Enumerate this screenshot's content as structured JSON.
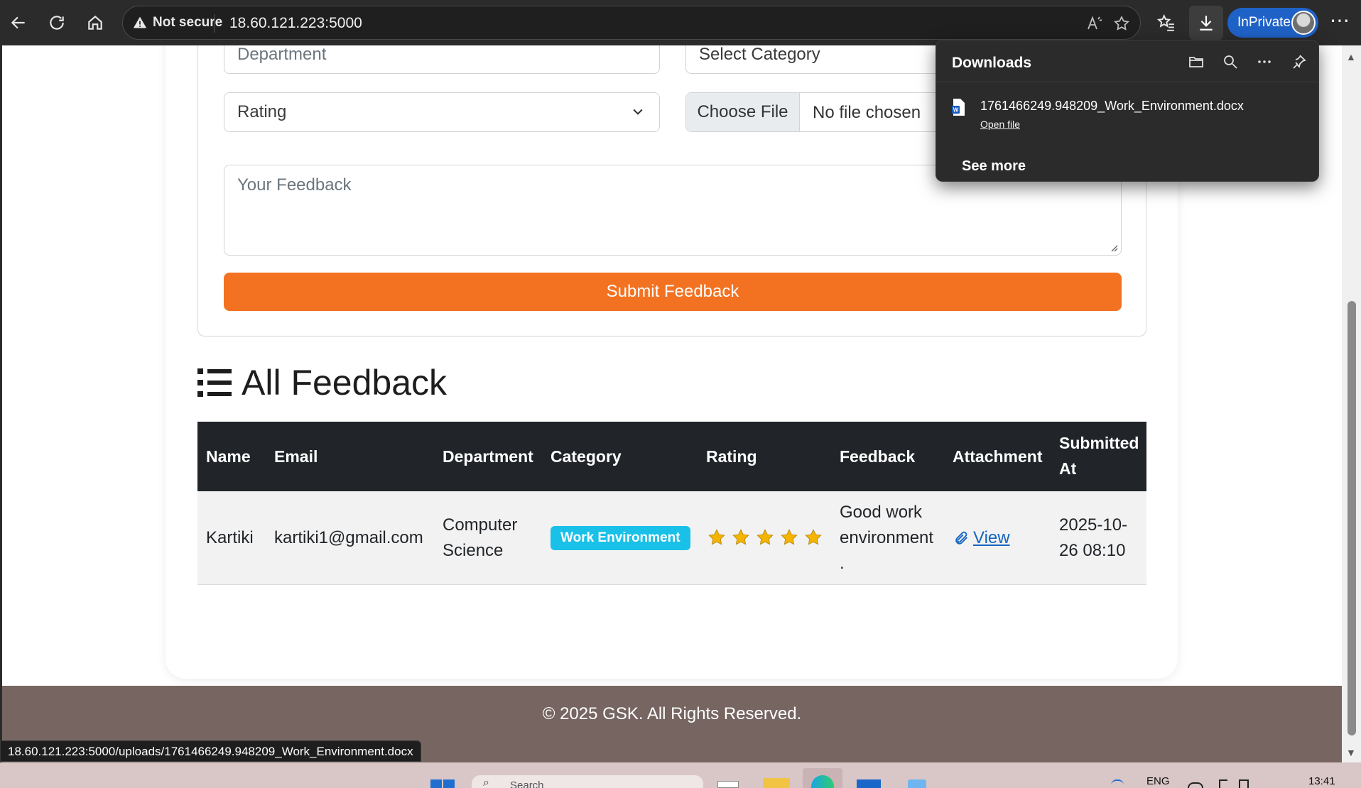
{
  "browser": {
    "security_label": "Not secure",
    "url": "18.60.121.223:5000",
    "inprivate_label": "InPrivate",
    "more_label": "⋯"
  },
  "downloads": {
    "title": "Downloads",
    "file_name": "1761466249.948209_Work_Environment.docx",
    "open_file_label": "Open file",
    "see_more_label": "See more"
  },
  "form": {
    "department_placeholder": "Department",
    "category_placeholder": "Select Category",
    "rating_placeholder": "Rating",
    "choose_file_label": "Choose File",
    "no_file_label": "No file chosen",
    "feedback_placeholder": "Your Feedback",
    "submit_label": "Submit Feedback"
  },
  "feedback_section": {
    "heading": "All Feedback",
    "columns": {
      "name": "Name",
      "email": "Email",
      "department": "Department",
      "category": "Category",
      "rating": "Rating",
      "feedback": "Feedback",
      "attachment": "Attachment",
      "submitted_line1": "Submitted",
      "submitted_line2": "At"
    },
    "rows": [
      {
        "name": "Kartiki",
        "email": "kartiki1@gmail.com",
        "department_line1": "Computer",
        "department_line2": "Science",
        "category": "Work Environment",
        "rating": 5,
        "feedback_line1": "Good work",
        "feedback_line2": "environment",
        "feedback_line3": ".",
        "attachment_label": "View",
        "submitted_line1": "2025-10-",
        "submitted_line2": "26 08:10"
      }
    ]
  },
  "footer": {
    "text": "© 2025 GSK. All Rights Reserved."
  },
  "status_bar": {
    "link_url": "18.60.121.223:5000/uploads/1761466249.948209_Work_Environment.docx"
  },
  "taskbar": {
    "search_placeholder": "Search",
    "language": "ENG",
    "time": "13:41"
  },
  "colors": {
    "accent_orange": "#f37221",
    "badge_cyan": "#19c0e8",
    "table_header": "#212529",
    "footer_brown": "#766560",
    "star_gold": "#f4b400"
  }
}
